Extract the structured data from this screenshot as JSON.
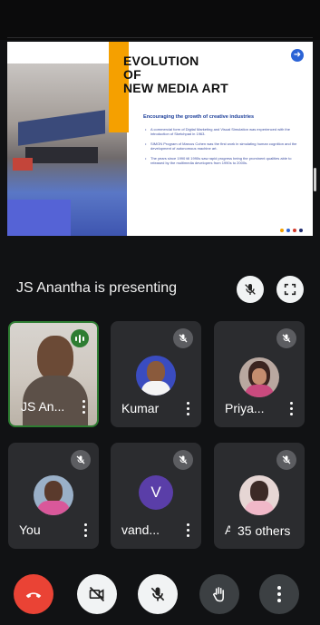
{
  "slide": {
    "title_lines": [
      "EVOLUTION",
      "OF",
      "NEW MEDIA ART"
    ],
    "subheading": "Encouraging the growth of creative industries",
    "bullets": [
      "A commercial form of Digital Marketing and Visual Simulation was experienced with the introduction of Sketchpad in 1963.",
      "SIMON Program of Marcus Cohen was the first work in simulating human cognition and the development of autonomous machine art.",
      "The years since 1990 till 1990s saw rapid progress being the prominent qualities able to released by the multimedia developers from 1990s to 2000s."
    ],
    "dot_colors": [
      "#f5a000",
      "#2b63d6",
      "#d33a2c",
      "#1e2a6e"
    ]
  },
  "presenter": {
    "text": "JS Anantha is presenting"
  },
  "participants": [
    {
      "name": "JS An...",
      "type": "video",
      "speaking": true
    },
    {
      "name": "Kumar",
      "type": "photo",
      "muted": true
    },
    {
      "name": "Priya...",
      "type": "photo",
      "muted": true
    },
    {
      "name": "You",
      "type": "photo",
      "muted": true
    },
    {
      "name": "vand...",
      "type": "letter",
      "letter": "V",
      "muted": true
    },
    {
      "name": "A",
      "type": "photo",
      "muted": true
    }
  ],
  "others_label": "35 others",
  "colors": {
    "end_call": "#ea4335",
    "tile_bg": "#2b2c2f",
    "speaking": "#2e7d32",
    "avatar_letter_bg": "#5a3ea8"
  },
  "icons": {
    "presentation_mute": "mic-off-icon",
    "fullscreen": "fullscreen-icon",
    "controls": [
      "end-call-icon",
      "camera-off-icon",
      "mic-off-icon",
      "raise-hand-icon",
      "more-options-icon"
    ]
  }
}
